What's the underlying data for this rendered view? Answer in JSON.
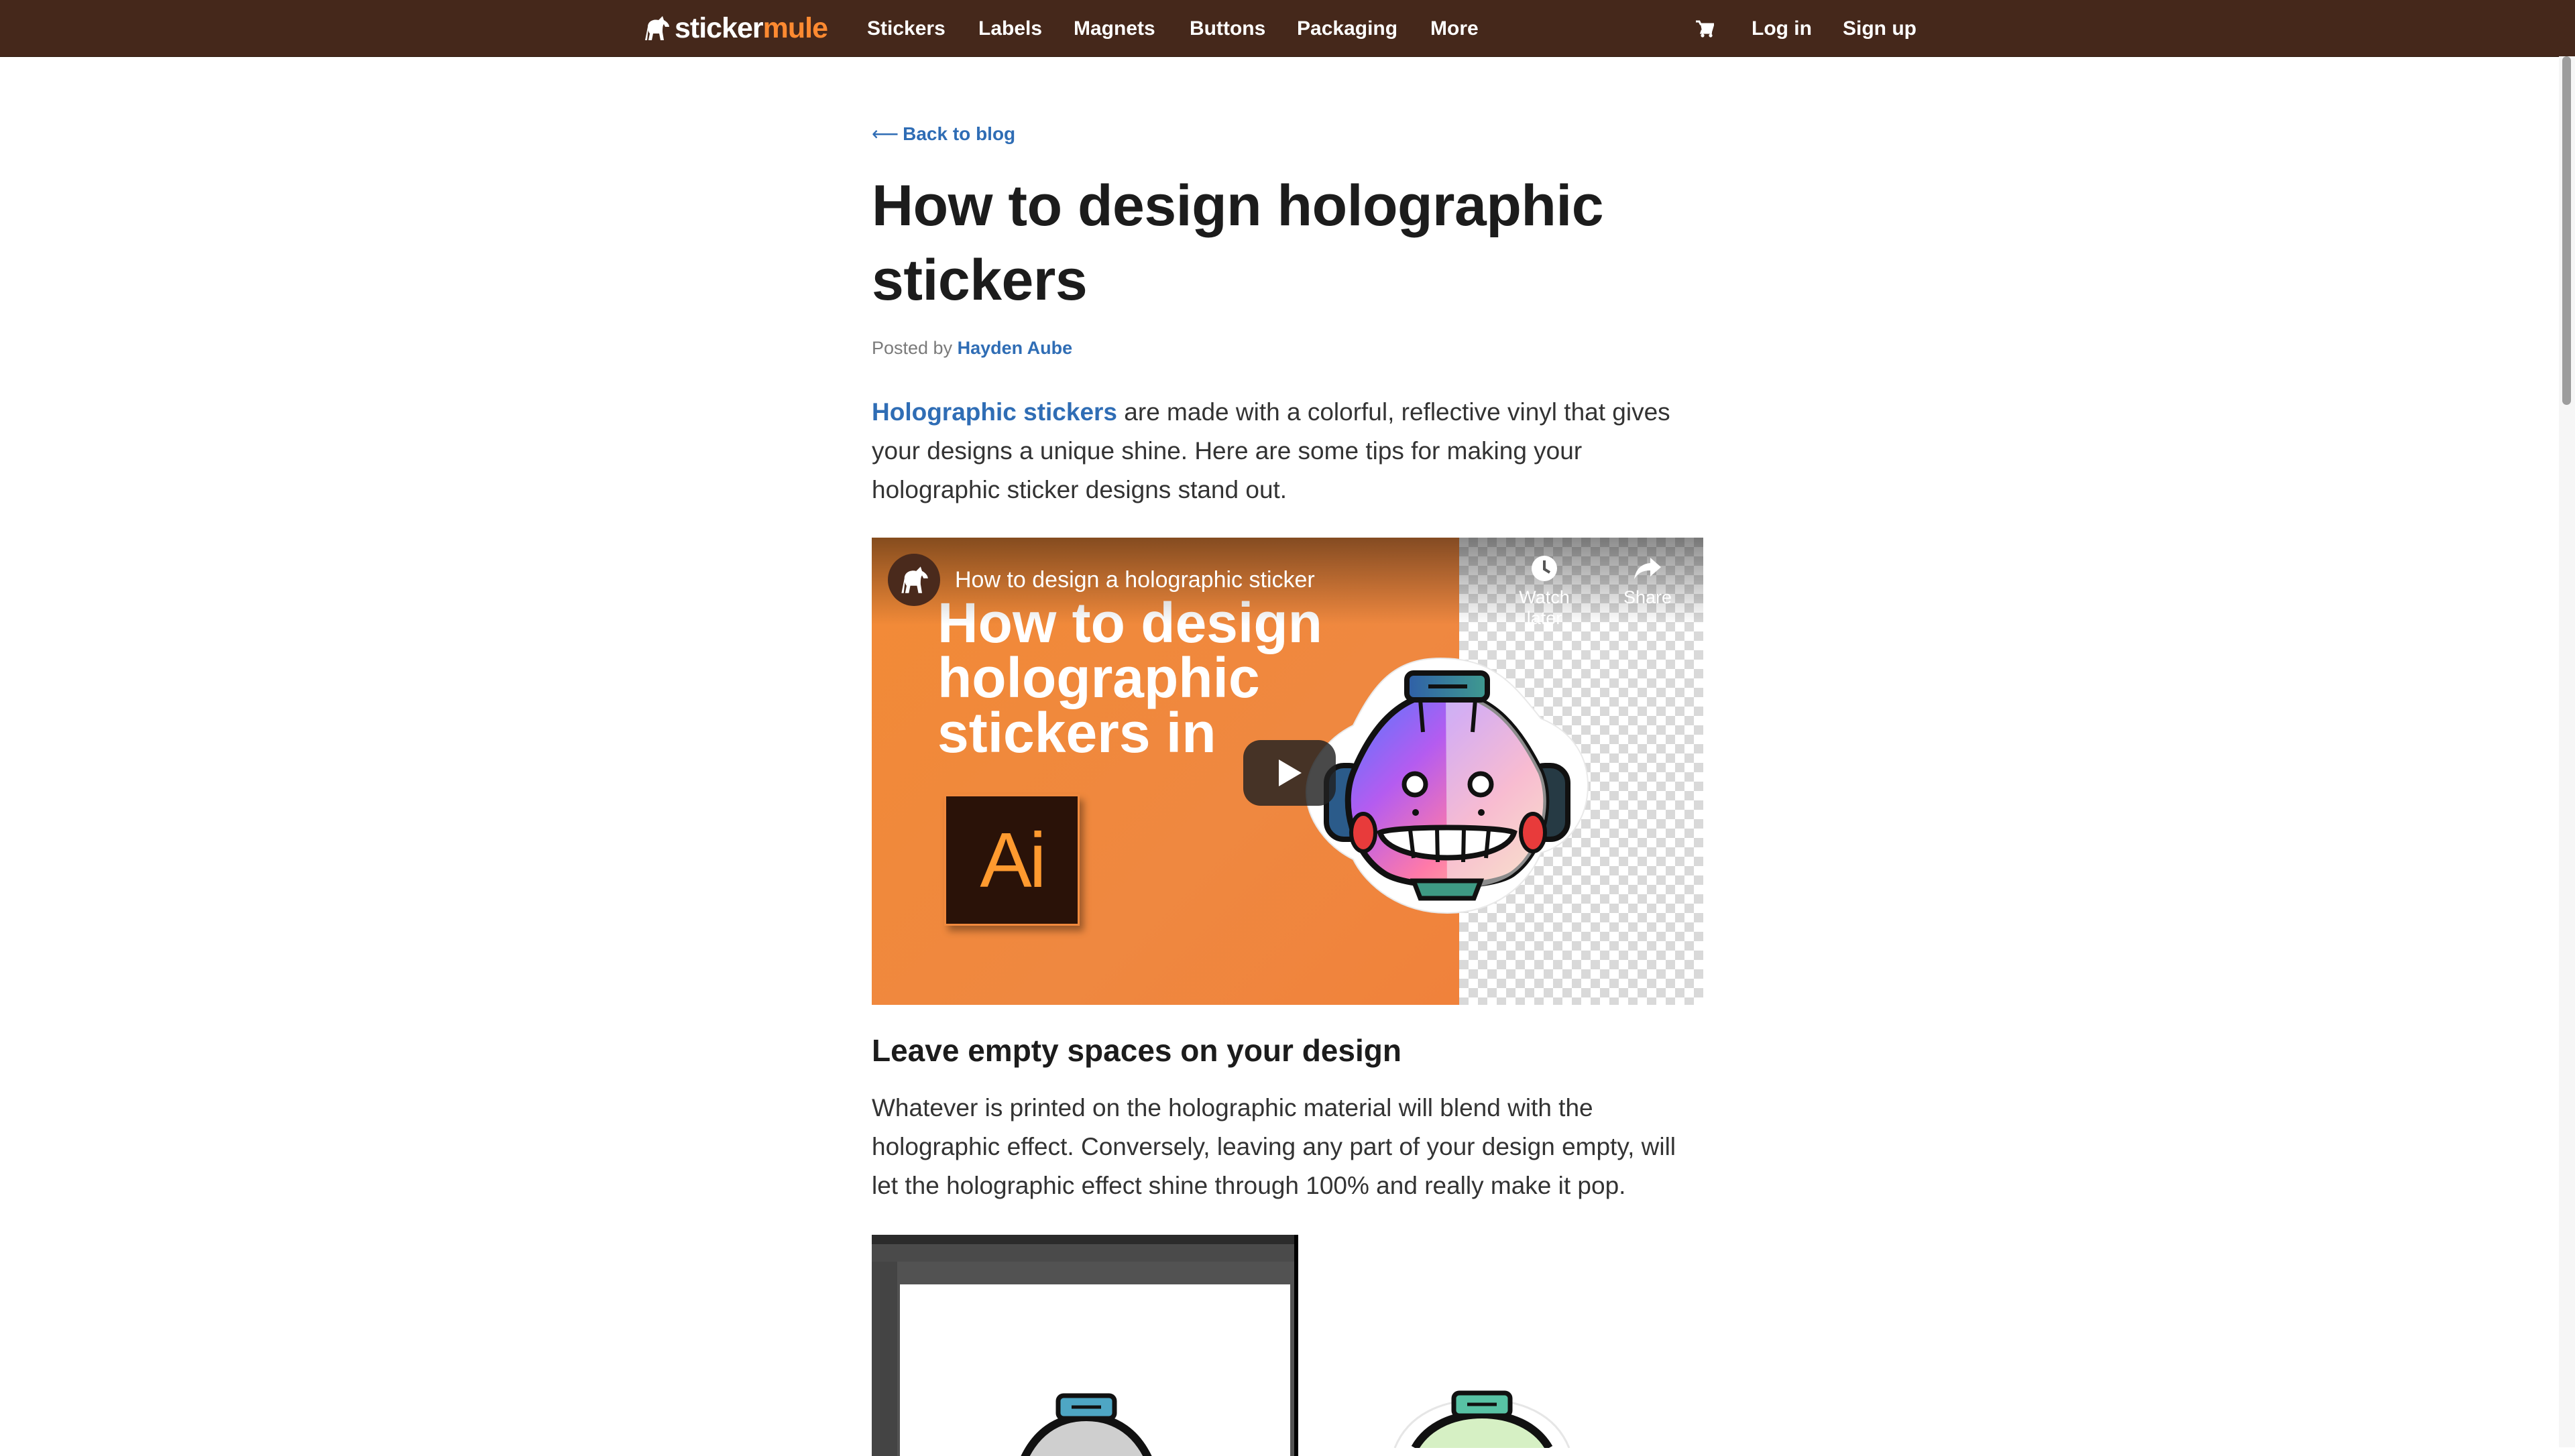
{
  "nav": {
    "logo": {
      "part1": "sticker",
      "part2": "mule"
    },
    "links": [
      "Stickers",
      "Labels",
      "Magnets",
      "Buttons",
      "Packaging",
      "More"
    ],
    "login": "Log in",
    "signup": "Sign up"
  },
  "article": {
    "back_label": "Back to blog",
    "title": "How to design holographic stickers",
    "byline_prefix": "Posted by",
    "author": "Hayden Aube",
    "intro_link": "Holographic stickers",
    "intro_text": " are made with a colorful, reflective vinyl that gives your designs a unique shine. Here are some tips for making your holographic sticker designs stand out.",
    "section1_heading": "Leave empty spaces on your design",
    "section1_text": "Whatever is printed on the holographic material will blend with the holographic effect. Conversely, leaving any part of your design empty, will let the holographic effect shine through 100% and really make it pop."
  },
  "video": {
    "title": "How to design a holographic sticker",
    "thumbnail_text": "How to design holographic stickers in",
    "ai_label": "Ai",
    "watch_later": "Watch later",
    "share": "Share"
  },
  "colors": {
    "nav_bg": "#45281b",
    "link": "#2f6db5",
    "brand_orange": "#ff8a31"
  }
}
